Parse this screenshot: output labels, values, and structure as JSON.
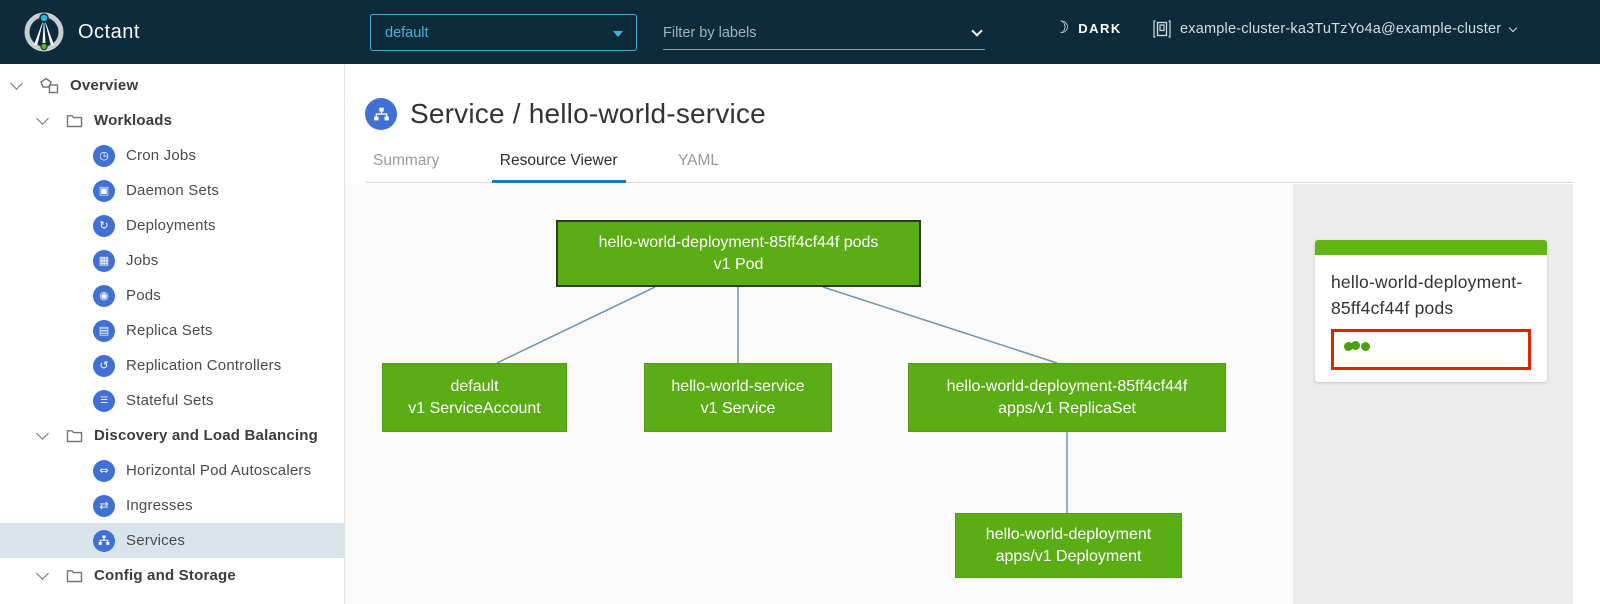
{
  "header": {
    "app_name": "Octant",
    "namespace_dropdown": {
      "value": "default"
    },
    "filter": {
      "placeholder": "Filter by labels"
    },
    "theme_toggle_label": "DARK",
    "cluster_selector": "example-cluster-ka3TuTzYo4a@example-cluster"
  },
  "sidebar": {
    "items": [
      {
        "label": "Overview",
        "icon": "objects-icon",
        "type": "group"
      },
      {
        "label": "Workloads",
        "icon": "folder-icon",
        "type": "group"
      },
      {
        "label": "Cron Jobs",
        "icon": "cronjob-icon",
        "type": "resource"
      },
      {
        "label": "Daemon Sets",
        "icon": "daemonset-icon",
        "type": "resource"
      },
      {
        "label": "Deployments",
        "icon": "deployment-icon",
        "type": "resource"
      },
      {
        "label": "Jobs",
        "icon": "job-icon",
        "type": "resource"
      },
      {
        "label": "Pods",
        "icon": "pod-icon",
        "type": "resource"
      },
      {
        "label": "Replica Sets",
        "icon": "replicaset-icon",
        "type": "resource"
      },
      {
        "label": "Replication Controllers",
        "icon": "replicationcontroller-icon",
        "type": "resource"
      },
      {
        "label": "Stateful Sets",
        "icon": "statefulset-icon",
        "type": "resource"
      },
      {
        "label": "Discovery and Load Balancing",
        "icon": "folder-icon",
        "type": "group"
      },
      {
        "label": "Horizontal Pod Autoscalers",
        "icon": "hpa-icon",
        "type": "resource"
      },
      {
        "label": "Ingresses",
        "icon": "ingress-icon",
        "type": "resource"
      },
      {
        "label": "Services",
        "icon": "service-icon",
        "type": "resource",
        "selected": true
      },
      {
        "label": "Config and Storage",
        "icon": "folder-icon",
        "type": "group"
      }
    ]
  },
  "main": {
    "resource_title": "Service / hello-world-service",
    "tabs": [
      {
        "label": "Summary",
        "active": false
      },
      {
        "label": "Resource Viewer",
        "active": true
      },
      {
        "label": "YAML",
        "active": false
      }
    ]
  },
  "graph": {
    "nodes": [
      {
        "name": "pod-node",
        "line1": "hello-world-deployment-85ff4cf44f pods",
        "line2": "v1 Pod",
        "selected": true
      },
      {
        "name": "serviceaccount-node",
        "line1": "default",
        "line2": "v1 ServiceAccount",
        "selected": false
      },
      {
        "name": "service-node",
        "line1": "hello-world-service",
        "line2": "v1 Service",
        "selected": false
      },
      {
        "name": "replicaset-node",
        "line1": "hello-world-deployment-85ff4cf44f",
        "line2": "apps/v1 ReplicaSet",
        "selected": false
      },
      {
        "name": "deployment-node",
        "line1": "hello-world-deployment",
        "line2": "apps/v1 Deployment",
        "selected": false
      }
    ]
  },
  "side_panel": {
    "card_title": "hello-world-deployment-85ff4cf44f pods",
    "status_dots": 3
  },
  "colors": {
    "header_bg": "#0d2b3b",
    "accent_blue": "#49afd9",
    "node_green": "#5aad15",
    "card_bar_green": "#60b515",
    "status_dot_green": "#4aa00d",
    "highlight_red": "#e12200",
    "selected_row_bg": "#d8e3ea",
    "tab_underline_blue": "#2279b5",
    "resource_icon_blue": "#4070d4"
  }
}
